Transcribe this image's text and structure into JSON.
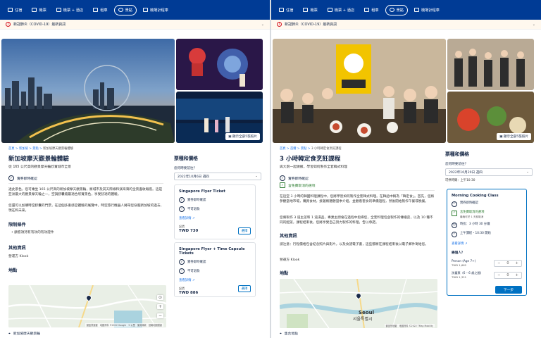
{
  "nav": {
    "items": [
      {
        "label": "住宿",
        "active": false
      },
      {
        "label": "機票",
        "active": false
      },
      {
        "label": "機票 + 酒店",
        "active": false
      },
      {
        "label": "租車",
        "active": false
      },
      {
        "label": "景點",
        "active": true
      },
      {
        "label": "機場計程車",
        "active": false
      }
    ]
  },
  "covid": {
    "text": "新冠肺炎（COVID-19）最新資訊"
  },
  "left": {
    "view_all": "顯示全部5張照片",
    "breadcrumb": [
      "首頁",
      "新加坡",
      "景點",
      "新加坡摩天觀景輪體驗"
    ],
    "title": "新加坡摩天觀景輪體驗",
    "subtitle": "從 165 公尺高的觀景摩天輪欣賞城市全景",
    "instant": "實券即時確認",
    "description_1": "透此景色，您可乘坐 165 公尺高的新加坡摩天觀景輪，將城市及其天際線和濱海灣的全景盡收眼底。這是亞洲最大的觀景摩天輪之一，空調膠囊廂最適合欣賞景色，享受舒適的體驗。",
    "description_2": "您還可以加購時空膠囊的門票，在這個多重感官體驗的展覽中，時空旅行機器人將帶您穿越新加坡的過去、現在和未來。",
    "restrictions_h": "限制條件",
    "restrictions": [
      "顧客須持有有效的有效證件"
    ],
    "other_h": "其他資訊",
    "operator": "營運方 Klook",
    "map_h": "地點",
    "map_credit": "鍵盤快速鍵　地圖資料 ©2022 Google　5 公里　使用條款　回報地圖錯誤",
    "location": "新加坡摩天觀景輪",
    "side": {
      "heading": "票種和價格",
      "when_label": "您何時要前往？",
      "date": "2022年10月6日 週四"
    },
    "tickets": [
      {
        "name": "Singapore Flyer Ticket",
        "f1": "實券即時確認",
        "f2": "不可退款",
        "link": "查看詳情",
        "from": "起價",
        "price": "TWD 730",
        "btn": "選擇"
      },
      {
        "name": "Singapore Flyer + Time Capsule Tickets",
        "f1": "實券即時確認",
        "f2": "不可退款",
        "link": "查看詳情",
        "from": "起價",
        "price": "TWD 886",
        "btn": "選擇"
      }
    ]
  },
  "right": {
    "view_all": "顯示全部5張照片",
    "breadcrumb": [
      "首頁",
      "首爾",
      "景點",
      "3 小時韓定食烹飪課程"
    ],
    "title": "3 小時韓定食烹飪課程",
    "subtitle": "與大廚一起做飯，學習如何製作全套韓式料理",
    "instant": "實券即時確認",
    "free_cancel": "含免費取消的選項",
    "description_1": "在這堂 3 小時的韓國料理課程中，您將學習如何製作全套韓式料理。在韓語中稱為「韓定食」。首先，您將參觀當地市場，購買食材，接著將聽聽當季介紹，並觀看套食的準備過程，然後開始製作午餐或晚餐。",
    "description_2": "您將製作 3 道主菜和 1 道湯品，專業主廚會在過程中指導您，全套料理包含製作的傳播菜，以及 10 種不同的配菜，課程結束後，您將享受自己努力製作的料理，告以承諾。",
    "other_h": "其他資訊",
    "other_text": "請注意：行程價格包含紀念照片與影片，以及食譜電子書，這些都將在課程結束後以電子郵件寄給您。",
    "operator": "營運方 Klook",
    "map_h": "地點",
    "map_city": "Seoul",
    "map_city_ko": "서울특별시",
    "map_credit": "鍵盤快速鍵　地圖資料 ©2022 TMap Mobility",
    "location": "集合地點",
    "side": {
      "heading": "票種和價格",
      "when_label": "您何時要前往？",
      "date": "2022年10月20日 週四",
      "time": "可供時間：上午10:30"
    },
    "booking": {
      "title": "Morning Cooking Class",
      "f1": "實券即時確認",
      "f2": "含免費取消的選項",
      "f2_sub": "最晚可於 1 天前取消",
      "f3": "時長：3 小時 30 分鐘",
      "f4": "上午課程・10:30 開始",
      "link": "查看詳情",
      "people_h": "幾個人？",
      "adult": "Person (Age 7+)",
      "adult_price": "TWD 1,662",
      "child": "孩童票（6 – 6 歲之間）",
      "child_price": "TWD 1,321",
      "adult_count": "0",
      "child_count": "0",
      "next": "下一步"
    }
  }
}
